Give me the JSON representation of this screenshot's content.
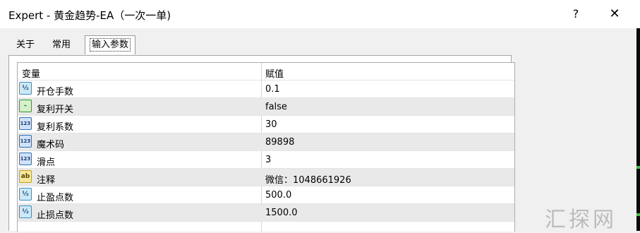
{
  "window": {
    "title": "Expert - 黄金趋势-EA（一次一单)",
    "help_label": "?",
    "close_label": "✕"
  },
  "tabs": [
    {
      "label": "关于"
    },
    {
      "label": "常用"
    },
    {
      "label": "输入参数",
      "active": true
    }
  ],
  "table": {
    "headers": [
      "变量",
      "赋值"
    ],
    "rows": [
      {
        "icon": "fraction-icon",
        "icon_text": "½",
        "name": "开仓手数",
        "value": "0.1"
      },
      {
        "icon": "boolean-icon",
        "icon_text": "⌁",
        "name": "复利开关",
        "value": "false"
      },
      {
        "icon": "integer-icon",
        "icon_text": "123",
        "name": "复利系数",
        "value": "30"
      },
      {
        "icon": "integer-icon",
        "icon_text": "123",
        "name": "魔术码",
        "value": "89898"
      },
      {
        "icon": "integer-icon",
        "icon_text": "123",
        "name": "滑点",
        "value": "3"
      },
      {
        "icon": "string-icon",
        "icon_text": "ab",
        "name": "注释",
        "value": "微信：1048661926"
      },
      {
        "icon": "fraction-icon",
        "icon_text": "½",
        "name": "止盈点数",
        "value": "500.0"
      },
      {
        "icon": "fraction-icon",
        "icon_text": "½",
        "name": "止损点数",
        "value": "1500.0"
      }
    ]
  },
  "watermark": "汇探网",
  "colors": {
    "active_tab_bg": "#ffffff",
    "alt_row_bg": "#e9e9e9",
    "chart_edge": "#0a0a0a",
    "chart_edge_accent": "#3fc04a"
  }
}
